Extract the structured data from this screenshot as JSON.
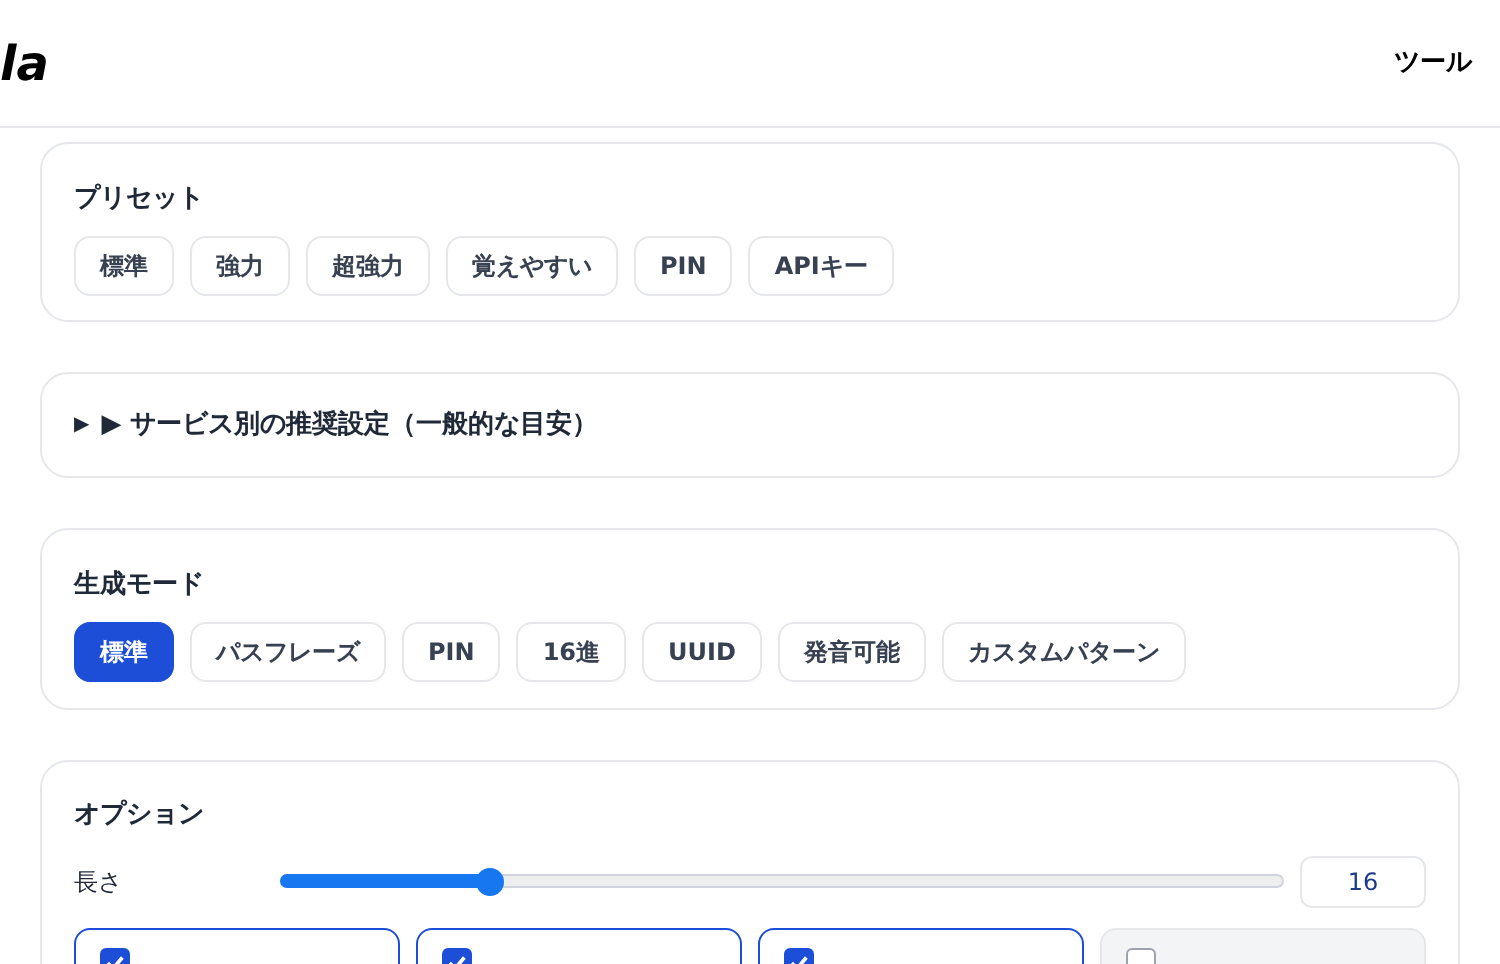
{
  "header": {
    "logo": "la",
    "nav": "ツール"
  },
  "presets": {
    "title": "プリセット",
    "items": [
      {
        "label": "標準"
      },
      {
        "label": "強力"
      },
      {
        "label": "超強力"
      },
      {
        "label": "覚えやすい"
      },
      {
        "label": "PIN"
      },
      {
        "label": "APIキー"
      }
    ]
  },
  "recommendations": {
    "marker": "▶",
    "title": "▶ サービス別の推奨設定（一般的な目安）",
    "expanded": false
  },
  "modes": {
    "title": "生成モード",
    "items": [
      {
        "label": "標準",
        "selected": true
      },
      {
        "label": "パスフレーズ",
        "selected": false
      },
      {
        "label": "PIN",
        "selected": false
      },
      {
        "label": "16進",
        "selected": false
      },
      {
        "label": "UUID",
        "selected": false
      },
      {
        "label": "発音可能",
        "selected": false
      },
      {
        "label": "カスタムパターン",
        "selected": false
      }
    ]
  },
  "options": {
    "title": "オプション",
    "length_label": "長さ",
    "level": 0.21,
    "length_value": "16",
    "checkboxes": [
      {
        "checked": true
      },
      {
        "checked": true
      },
      {
        "checked": true
      },
      {
        "checked": false
      }
    ]
  }
}
